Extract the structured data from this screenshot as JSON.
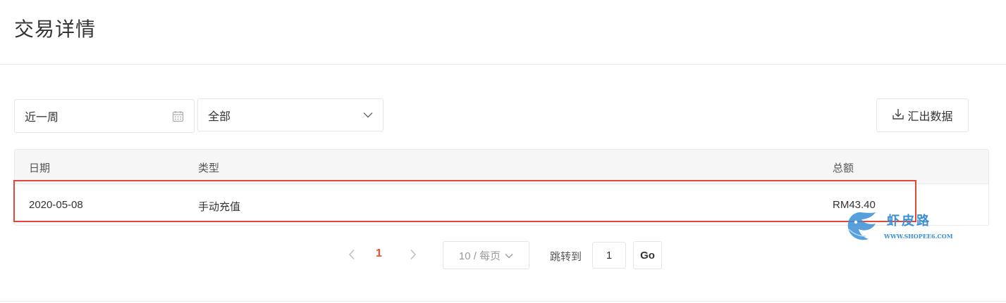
{
  "header": {
    "title": "交易详情"
  },
  "filters": {
    "date_range": {
      "value": "近一周",
      "icon": "calendar-icon"
    },
    "type": {
      "value": "全部",
      "icon": "chevron-down-icon"
    },
    "export_label": "汇出数据"
  },
  "table": {
    "columns": {
      "date": "日期",
      "type": "类型",
      "amount": "总额"
    },
    "rows": [
      {
        "date": "2020-05-08",
        "type": "手动充值",
        "amount": "RM43.40"
      }
    ]
  },
  "pagination": {
    "current_page": "1",
    "page_size": "10 / 每页",
    "jump_label": "跳转到",
    "jump_value": "1",
    "go_label": "Go"
  },
  "watermark": {
    "text": "虾皮路",
    "url": "WWW.SHOPEE6.COM"
  },
  "colors": {
    "accent": "#ee4d2d",
    "highlight": "#e0463b",
    "watermark": "#3a8fd6"
  }
}
